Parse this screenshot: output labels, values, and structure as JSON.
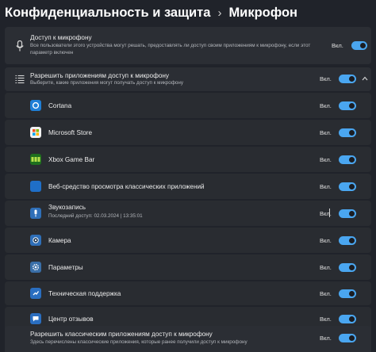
{
  "header": {
    "parent": "Конфиденциальность и защита",
    "separator": "›",
    "current": "Микрофон"
  },
  "access": {
    "title": "Доступ к микрофону",
    "desc": "Все пользователи этого устройства могут решать, предоставлять ли доступ своим приложениям к микрофону, если этот параметр включен",
    "state": "Вкл.",
    "on": true,
    "icon": "microphone-icon"
  },
  "apps_access": {
    "title": "Разрешить приложениям доступ к микрофону",
    "desc": "Выберите, какие приложения могут получать доступ к микрофону",
    "state": "Вкл.",
    "on": true,
    "icon": "app-list-icon",
    "expand_icon": "chevron-up-icon"
  },
  "apps": [
    {
      "name": "Cortana",
      "state": "Вкл.",
      "on": true,
      "icon": "cortana-icon",
      "color": "#1f7fd6"
    },
    {
      "name": "Microsoft Store",
      "state": "Вкл.",
      "on": true,
      "icon": "microsoft-store-icon",
      "color": "#f2f2f2"
    },
    {
      "name": "Xbox Game Bar",
      "state": "Вкл.",
      "on": true,
      "icon": "xbox-game-bar-icon",
      "color": "#1e6f1e"
    },
    {
      "name": "Веб-средство просмотра классических приложений",
      "state": "Вкл.",
      "on": true,
      "icon": "web-viewer-icon",
      "color": "#1f6fc8"
    },
    {
      "name": "Звукозапись",
      "desc": "Последний доступ: 02.03.2024  |  13:35:01",
      "state": "Вкл.",
      "on": true,
      "icon": "voice-recorder-icon",
      "color": "#2f6fb8"
    },
    {
      "name": "Камера",
      "state": "Вкл.",
      "on": true,
      "icon": "camera-icon",
      "color": "#2f6fb8"
    },
    {
      "name": "Параметры",
      "state": "Вкл.",
      "on": true,
      "icon": "settings-gear-icon",
      "color": "#3a6fa8"
    },
    {
      "name": "Техническая поддержка",
      "state": "Вкл.",
      "on": true,
      "icon": "get-help-icon",
      "color": "#2a6ec0"
    },
    {
      "name": "Центр отзывов",
      "state": "Вкл.",
      "on": true,
      "icon": "feedback-hub-icon",
      "color": "#2a6ec0"
    }
  ],
  "desktop_access": {
    "title": "Разрешить классическим приложениям доступ к микрофону",
    "desc": "Здесь перечислены классические приложения, которые ранее получили доступ к микрофону",
    "state": "Вкл.",
    "on": true
  },
  "colors": {
    "accent": "#4aa6f0",
    "background": "#20232a",
    "card": "#2b2e34"
  }
}
